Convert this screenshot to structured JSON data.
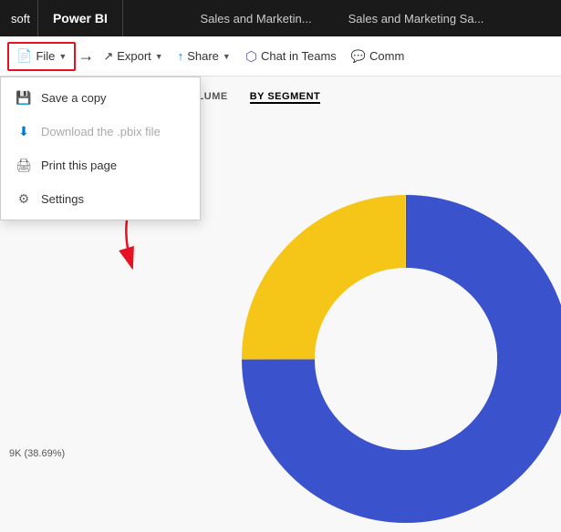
{
  "titleBar": {
    "logo": "soft",
    "powerbi": "Power BI",
    "centerItems": [
      "Sales and Marketin...",
      "Sales and Marketing Sa..."
    ]
  },
  "toolbar": {
    "fileLabel": "File",
    "exportLabel": "Export",
    "shareLabel": "Share",
    "chatInTeamsLabel": "Chat in Teams",
    "commLabel": "Comm"
  },
  "dropdown": {
    "items": [
      {
        "id": "save-copy",
        "label": "Save a copy",
        "icon": "💾",
        "iconClass": "purple",
        "disabled": false
      },
      {
        "id": "download-pbix",
        "label": "Download the .pbix file",
        "icon": "⬇",
        "iconClass": "blue",
        "disabled": true
      },
      {
        "id": "print-page",
        "label": "Print this page",
        "icon": "🖨",
        "iconClass": "gray",
        "disabled": false
      },
      {
        "id": "settings",
        "label": "Settings",
        "icon": "⚙",
        "iconClass": "gray",
        "disabled": false
      }
    ]
  },
  "segmentTabs": {
    "byVolume": "BY VOLUME",
    "bySegment": "BY SEGMENT"
  },
  "chartLabel": "9K (38.69%)",
  "chart": {
    "colors": [
      "#3a52cc",
      "#f5c518"
    ],
    "bluePercent": 75,
    "yellowPercent": 25
  }
}
